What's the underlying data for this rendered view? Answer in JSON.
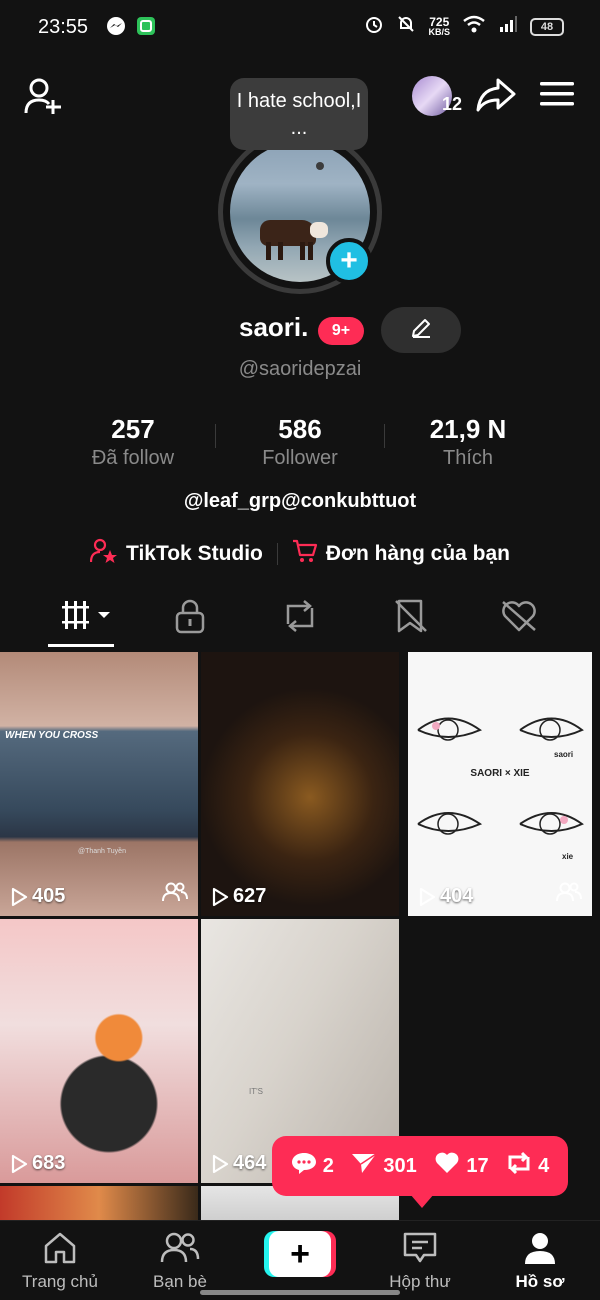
{
  "status_bar": {
    "time": "23:55",
    "net_speed_value": "725",
    "net_speed_unit": "KB/S",
    "battery": "48",
    "icons": [
      "messenger-icon",
      "app-notification-icon",
      "alarm-icon",
      "mute-icon",
      "wifi-icon",
      "signal-icon",
      "battery-icon"
    ]
  },
  "header": {
    "notification_count": "12",
    "icons": [
      "add-friend-icon",
      "share-icon",
      "menu-icon"
    ]
  },
  "profile": {
    "note_bubble": "I hate school,I ...",
    "display_name": "saori.",
    "name_badge": "9+",
    "username": "@saoridepzai",
    "stats": [
      {
        "value": "257",
        "label": "Đã follow"
      },
      {
        "value": "586",
        "label": "Follower"
      },
      {
        "value": "21,9 N",
        "label": "Thích"
      }
    ],
    "bio": "@leaf_grp@conkubttuot",
    "links": [
      {
        "label": "TikTok Studio",
        "icon": "creator-star-icon"
      },
      {
        "label": "Đơn hàng của bạn",
        "icon": "shopping-cart-icon"
      }
    ]
  },
  "tabs": [
    {
      "name": "videos",
      "icon": "grid-icon",
      "active": true
    },
    {
      "name": "private",
      "icon": "lock-icon"
    },
    {
      "name": "reposts",
      "icon": "repost-icon"
    },
    {
      "name": "favorites",
      "icon": "bookmark-icon"
    },
    {
      "name": "liked",
      "icon": "heart-hidden-icon"
    }
  ],
  "videos": [
    {
      "views": "405",
      "friends_icon": true,
      "overlay_text": "WHEN YOU CROSS",
      "credit": "@Thanh Tuyền"
    },
    {
      "views": "627",
      "friends_icon": false
    },
    {
      "views": "404",
      "friends_icon": true,
      "overlay_text": "SAORI × XIE",
      "corner_text_1": "saori",
      "corner_text_2": "xie"
    },
    {
      "views": "683",
      "friends_icon": false
    },
    {
      "views": "464",
      "friends_icon": false,
      "overlay_text": "IT'S"
    }
  ],
  "activity_popup": {
    "comments": "2",
    "shares": "301",
    "likes": "17",
    "reposts": "4"
  },
  "bottom_nav": [
    {
      "label": "Trang chủ",
      "icon": "home-icon"
    },
    {
      "label": "Bạn bè",
      "icon": "friends-icon"
    },
    {
      "label": "",
      "icon": "create-plus-icon"
    },
    {
      "label": "Hộp thư",
      "icon": "inbox-icon"
    },
    {
      "label": "Hồ sơ",
      "icon": "profile-icon",
      "active": true
    }
  ],
  "colors": {
    "background": "#121212",
    "accent_red": "#fe2c55",
    "accent_cyan": "#25f4ee",
    "plus_badge": "#20bfe3",
    "muted_text": "#8a8a8a"
  }
}
